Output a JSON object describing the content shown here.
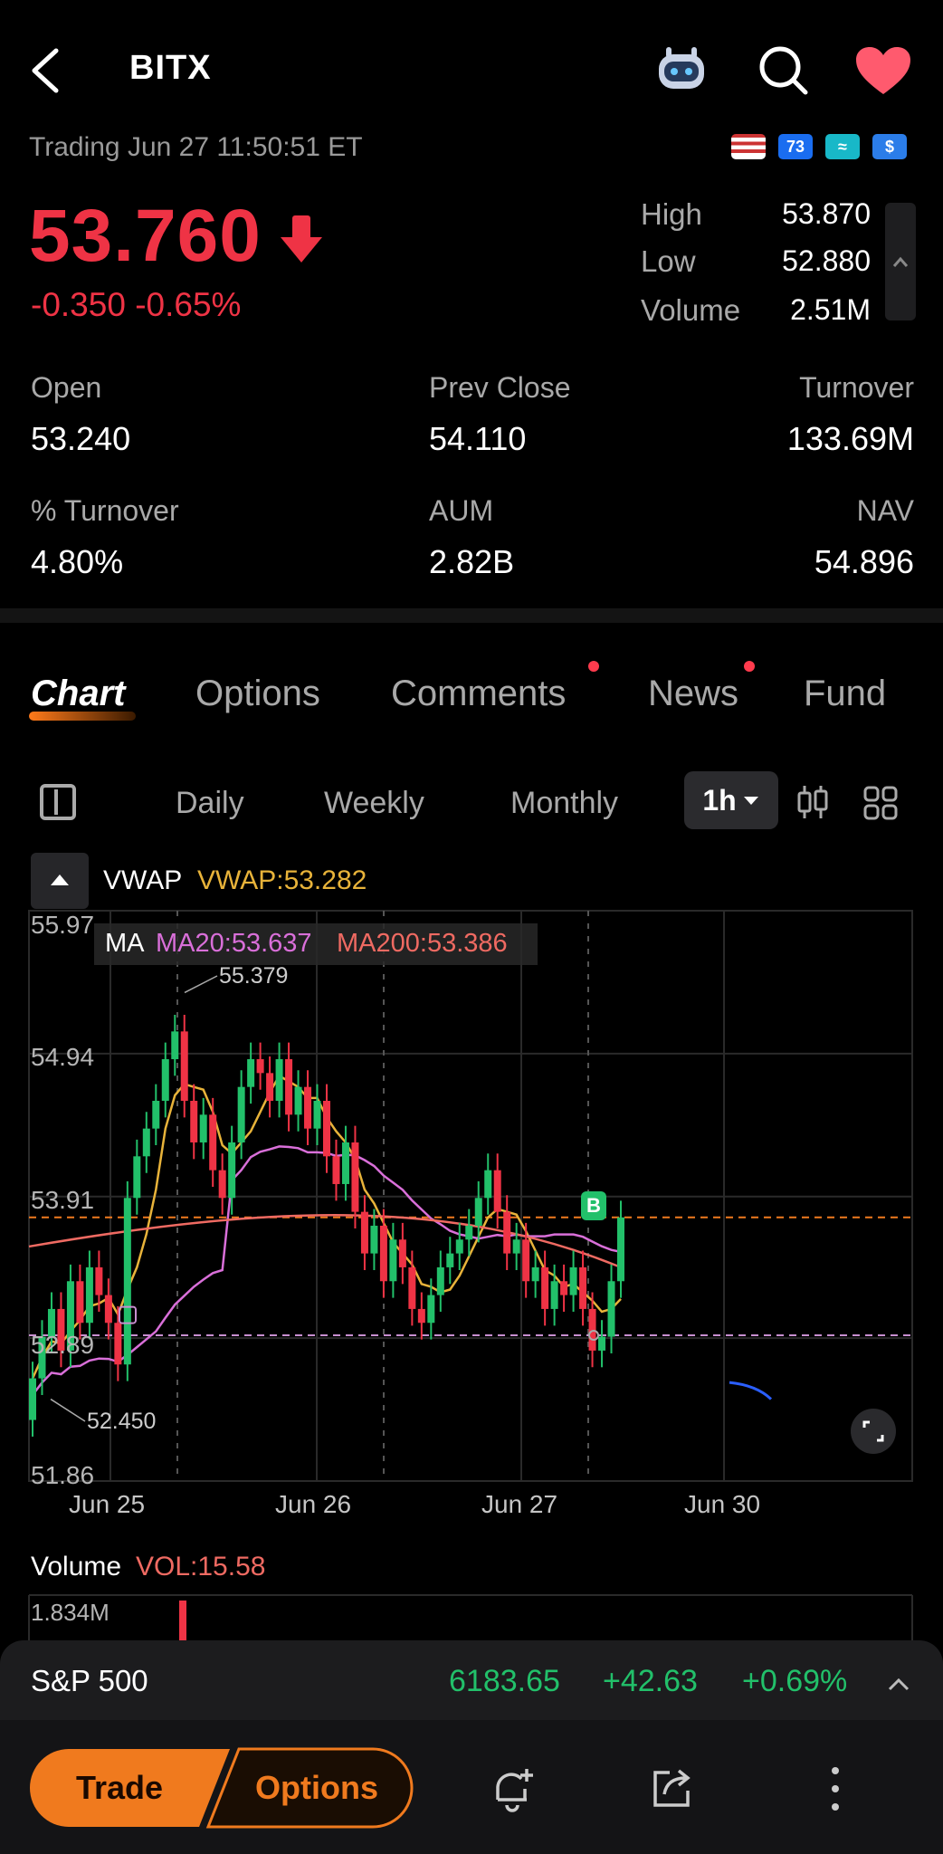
{
  "header": {
    "ticker": "BITX"
  },
  "status_line": "Trading   Jun 27 11:50:51 ET",
  "flags": [
    "US",
    "73",
    "≈",
    "$"
  ],
  "quote": {
    "price": "53.760",
    "change": "-0.350 -0.65%",
    "high_label": "High",
    "high": "53.870",
    "low_label": "Low",
    "low": "52.880",
    "volume_label": "Volume",
    "volume": "2.51M"
  },
  "stats": [
    {
      "label": "Open",
      "value": "53.240"
    },
    {
      "label": "Prev Close",
      "value": "54.110"
    },
    {
      "label": "Turnover",
      "value": "133.69M"
    },
    {
      "label": "% Turnover",
      "value": "4.80%"
    },
    {
      "label": "AUM",
      "value": "2.82B"
    },
    {
      "label": "NAV",
      "value": "54.896"
    }
  ],
  "tabs": [
    "Chart",
    "Options",
    "Comments",
    "News",
    "Fund"
  ],
  "periods": [
    "Daily",
    "Weekly",
    "Monthly",
    "1h"
  ],
  "chart": {
    "vwap_label": "VWAP",
    "vwap_value": "VWAP:53.282",
    "ma_label": "MA",
    "ma20": "MA20:53.637",
    "ma200": "MA200:53.386",
    "y_ticks": [
      "55.97",
      "54.94",
      "53.91",
      "52.89",
      "51.86"
    ],
    "x_ticks": [
      "Jun 25",
      "Jun 26",
      "Jun 27",
      "Jun 30"
    ],
    "high_marker": "55.379",
    "low_marker": "52.450",
    "buy_marker": "B"
  },
  "chart_data": {
    "type": "candlestick",
    "x": [
      "Jun 25",
      "Jun 26",
      "Jun 27",
      "Jun 30"
    ],
    "ylim": [
      51.86,
      55.97
    ],
    "reference_lines": {
      "current_price": 53.76,
      "avg_cost": 52.89
    },
    "annotations": {
      "high": 55.379,
      "low": 52.45
    }
  },
  "volume": {
    "label": "Volume",
    "value": "VOL:15.58",
    "max": "1.834M"
  },
  "index": {
    "name": "S&P 500",
    "value": "6183.65",
    "change": "+42.63",
    "pct": "+0.69%"
  },
  "bottom": {
    "trade": "Trade",
    "options": "Options"
  },
  "colors": {
    "up": "#22c06a",
    "down": "#ef3345",
    "accent": "#f07a1e"
  }
}
